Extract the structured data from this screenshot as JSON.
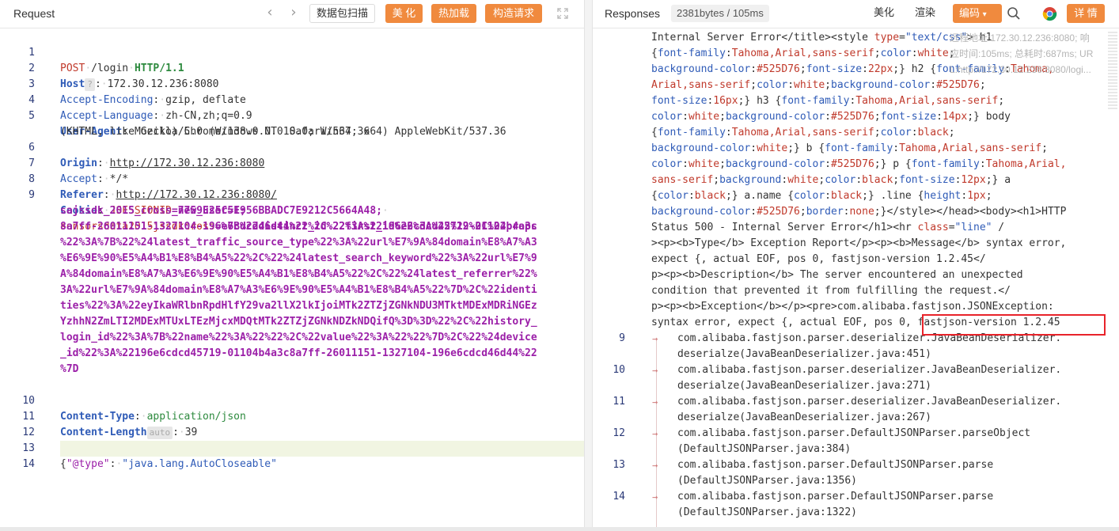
{
  "request": {
    "title": "Request",
    "buttons": {
      "scan": "数据包扫描",
      "beautify": "美 化",
      "hot_load": "热加载",
      "construct": "构造请求"
    },
    "lines": {
      "l1": {
        "method": "POST",
        "path": "/login",
        "proto": "HTTP/1.1"
      },
      "l2": {
        "name": "Host",
        "hint": "?",
        "value": "172.30.12.236:8080"
      },
      "l3": {
        "name": "Accept-Encoding",
        "value": "gzip, deflate"
      },
      "l4": {
        "name": "Accept-Language",
        "value": "zh-CN,zh;q=0.9"
      },
      "l5": {
        "name": "User-Agent",
        "value": "Mozilla/5.0 (Windows NT 10.0; Win64; x64) AppleWebKit/537.36",
        "value2": "(KHTML, like Gecko) Chrome/138.0.0.0 Safari/537.36"
      },
      "l6": {
        "name": "Origin",
        "value": "http://172.30.12.236:8080"
      },
      "l7": {
        "name": "Accept",
        "value": "*/*"
      },
      "l8": {
        "name": "Referer",
        "value": "http://172.30.12.236:8080/"
      },
      "l9": {
        "name": "Cookie",
        "ck1_name": "JSESSIONID",
        "ck1_value": "=7759E25C5F956BBADC7E9212C5664A48;",
        "ck2": "sajssdk_2015_cross_new_user=1;",
        "ck3_name": "sensorsdata2015jssdkcross",
        "ck3_rows": [
          "=%7B%22distinct_id%22%3A%22196e6cdcd45719-01104b4a3c",
          "8a7ff-26011151-1327104-196e6cdcd46d44%22%2C%22first_id%22%3A%22%22%2C%22props",
          "%22%3A%7B%22%24latest_traffic_source_type%22%3A%22url%E7%9A%84domain%E8%A7%A3",
          "%E6%9E%90%E5%A4%B1%E8%B4%A5%22%2C%22%24latest_search_keyword%22%3A%22url%E7%9",
          "A%84domain%E8%A7%A3%E6%9E%90%E5%A4%B1%E8%B4%A5%22%2C%22%24latest_referrer%22%",
          "3A%22url%E7%9A%84domain%E8%A7%A3%E6%9E%90%E5%A4%B1%E8%B4%A5%22%7D%2C%22identi",
          "ties%22%3A%22eyIkaWRlbnRpdHlfY29va2llX2lkIjoiMTk2ZTZjZGNkNDU3MTktMDExMDRiNGEz",
          "YzhhN2ZmLTI2MDExMTUxLTEzMjcxMDQtMTk2ZTZjZGNkNDZkNDQifQ%3D%3D%22%2C%22history_",
          "login_id%22%3A%7B%22name%22%3A%22%22%2C%22value%22%3A%22%22%7D%2C%22%24device",
          "_id%22%3A%22196e6cdcd45719-01104b4a3c8a7ff-26011151-1327104-196e6cdcd46d44%22",
          "%7D"
        ]
      },
      "l10": {
        "name": "Content-Type",
        "value": "application/json"
      },
      "l11": {
        "name": "Content-Length",
        "hint": "auto",
        "value": "39"
      },
      "l13": {
        "key": "\"@type\"",
        "sep": ":",
        "value": "\"java.lang.AutoCloseable\""
      }
    },
    "line_numbers": [
      "1",
      "2",
      "3",
      "4",
      "5",
      "6",
      "7",
      "8",
      "9",
      "10",
      "11",
      "12",
      "13",
      "14"
    ]
  },
  "response": {
    "title": "Responses",
    "size_badge": "2381bytes / 105ms",
    "buttons": {
      "beautify": "美化",
      "render": "渲染",
      "encoding": "编码",
      "details": "详 情"
    },
    "ghost_lines": [
      "远程地址:172.30.12.236:8080; 响",
      "应时间:105ms; 总耗时:687ms; UR",
      "L:http://172.30.12.236:8080/logi..."
    ],
    "html_rows": [
      {
        "parts": [
          [
            "t",
            "Internal Server Error</title><style "
          ],
          [
            "a",
            "type"
          ],
          [
            "t",
            "="
          ],
          [
            "s",
            "\"text/css\""
          ],
          [
            "t",
            "> h1 "
          ]
        ]
      },
      {
        "parts": [
          [
            "t",
            "{"
          ],
          [
            "p",
            "font-family"
          ],
          [
            "t",
            ":"
          ],
          [
            "v",
            "Tahoma,Arial,sans-serif"
          ],
          [
            "t",
            ";"
          ],
          [
            "p",
            "color"
          ],
          [
            "t",
            ":"
          ],
          [
            "v",
            "white"
          ],
          [
            "t",
            ";"
          ]
        ]
      },
      {
        "parts": [
          [
            "p",
            "background-color"
          ],
          [
            "t",
            ":"
          ],
          [
            "v",
            "#525D76"
          ],
          [
            "t",
            ";"
          ],
          [
            "p",
            "font-size"
          ],
          [
            "t",
            ":"
          ],
          [
            "v",
            "22px"
          ],
          [
            "t",
            ";} h2 {"
          ],
          [
            "p",
            "font-family"
          ],
          [
            "t",
            ":"
          ],
          [
            "v",
            "Tahoma,"
          ]
        ]
      },
      {
        "parts": [
          [
            "v",
            "Arial,sans-serif"
          ],
          [
            "t",
            ";"
          ],
          [
            "p",
            "color"
          ],
          [
            "t",
            ":"
          ],
          [
            "v",
            "white"
          ],
          [
            "t",
            ";"
          ],
          [
            "p",
            "background-color"
          ],
          [
            "t",
            ":"
          ],
          [
            "v",
            "#525D76"
          ],
          [
            "t",
            ";"
          ]
        ]
      },
      {
        "parts": [
          [
            "p",
            "font-size"
          ],
          [
            "t",
            ":"
          ],
          [
            "v",
            "16px"
          ],
          [
            "t",
            ";} h3 {"
          ],
          [
            "p",
            "font-family"
          ],
          [
            "t",
            ":"
          ],
          [
            "v",
            "Tahoma,Arial,sans-serif"
          ],
          [
            "t",
            ";"
          ]
        ]
      },
      {
        "parts": [
          [
            "p",
            "color"
          ],
          [
            "t",
            ":"
          ],
          [
            "v",
            "white"
          ],
          [
            "t",
            ";"
          ],
          [
            "p",
            "background-color"
          ],
          [
            "t",
            ":"
          ],
          [
            "v",
            "#525D76"
          ],
          [
            "t",
            ";"
          ],
          [
            "p",
            "font-size"
          ],
          [
            "t",
            ":"
          ],
          [
            "v",
            "14px"
          ],
          [
            "t",
            ";} body"
          ]
        ]
      },
      {
        "parts": [
          [
            "t",
            "{"
          ],
          [
            "p",
            "font-family"
          ],
          [
            "t",
            ":"
          ],
          [
            "v",
            "Tahoma,Arial,sans-serif"
          ],
          [
            "t",
            ";"
          ],
          [
            "p",
            "color"
          ],
          [
            "t",
            ":"
          ],
          [
            "v",
            "black"
          ],
          [
            "t",
            ";"
          ]
        ]
      },
      {
        "parts": [
          [
            "p",
            "background-color"
          ],
          [
            "t",
            ":"
          ],
          [
            "v",
            "white"
          ],
          [
            "t",
            ";} b {"
          ],
          [
            "p",
            "font-family"
          ],
          [
            "t",
            ":"
          ],
          [
            "v",
            "Tahoma,Arial,sans-serif"
          ],
          [
            "t",
            ";"
          ]
        ]
      },
      {
        "parts": [
          [
            "p",
            "color"
          ],
          [
            "t",
            ":"
          ],
          [
            "v",
            "white"
          ],
          [
            "t",
            ";"
          ],
          [
            "p",
            "background-color"
          ],
          [
            "t",
            ":"
          ],
          [
            "v",
            "#525D76"
          ],
          [
            "t",
            ";} p {"
          ],
          [
            "p",
            "font-family"
          ],
          [
            "t",
            ":"
          ],
          [
            "v",
            "Tahoma,Arial,"
          ]
        ]
      },
      {
        "parts": [
          [
            "v",
            "sans-serif"
          ],
          [
            "t",
            ";"
          ],
          [
            "p",
            "background"
          ],
          [
            "t",
            ":"
          ],
          [
            "v",
            "white"
          ],
          [
            "t",
            ";"
          ],
          [
            "p",
            "color"
          ],
          [
            "t",
            ":"
          ],
          [
            "v",
            "black"
          ],
          [
            "t",
            ";"
          ],
          [
            "p",
            "font-size"
          ],
          [
            "t",
            ":"
          ],
          [
            "v",
            "12px"
          ],
          [
            "t",
            ";} a"
          ]
        ]
      },
      {
        "parts": [
          [
            "t",
            "{"
          ],
          [
            "p",
            "color"
          ],
          [
            "t",
            ":"
          ],
          [
            "v",
            "black"
          ],
          [
            "t",
            ";} a.name {"
          ],
          [
            "p",
            "color"
          ],
          [
            "t",
            ":"
          ],
          [
            "v",
            "black"
          ],
          [
            "t",
            ";} .line {"
          ],
          [
            "p",
            "height"
          ],
          [
            "t",
            ":"
          ],
          [
            "v",
            "1px"
          ],
          [
            "t",
            ";"
          ]
        ]
      },
      {
        "parts": [
          [
            "p",
            "background-color"
          ],
          [
            "t",
            ":"
          ],
          [
            "v",
            "#525D76"
          ],
          [
            "t",
            ";"
          ],
          [
            "p",
            "border"
          ],
          [
            "t",
            ":"
          ],
          [
            "v",
            "none"
          ],
          [
            "t",
            ";}</style></head><body><h1>HTTP"
          ]
        ]
      },
      {
        "parts": [
          [
            "t",
            "Status 500 - Internal Server Error</h1><hr "
          ],
          [
            "a",
            "class"
          ],
          [
            "t",
            "="
          ],
          [
            "s",
            "\"line\""
          ],
          [
            "t",
            " /"
          ]
        ]
      },
      {
        "parts": [
          [
            "t",
            "><p><b>Type</b> Exception Report</p><p><b>Message</b> syntax error,"
          ]
        ]
      },
      {
        "parts": [
          [
            "t",
            "expect {, actual EOF, pos 0, fastjson-version 1.2.45</"
          ]
        ]
      },
      {
        "parts": [
          [
            "t",
            "p><p><b>Description</b> The server encountered an unexpected"
          ]
        ]
      },
      {
        "parts": [
          [
            "t",
            "condition that prevented it from fulfilling the request.</"
          ]
        ]
      },
      {
        "parts": [
          [
            "t",
            "p><p><b>Exception</b></p><pre>com.alibaba.fastjson.JSONException:"
          ]
        ]
      },
      {
        "parts": [
          [
            "t",
            "syntax error, expect {, actual EOF, pos 0, fastjson-version 1.2.45"
          ]
        ]
      }
    ],
    "stack_rows": [
      {
        "num": "9",
        "l1": "com.alibaba.fastjson.parser.deserializer.JavaBeanDeserializer.",
        "l2": "deserialze(JavaBeanDeserializer.java:451)"
      },
      {
        "num": "10",
        "l1": "com.alibaba.fastjson.parser.deserializer.JavaBeanDeserializer.",
        "l2": "deserialze(JavaBeanDeserializer.java:271)"
      },
      {
        "num": "11",
        "l1": "com.alibaba.fastjson.parser.deserializer.JavaBeanDeserializer.",
        "l2": "deserialze(JavaBeanDeserializer.java:267)"
      },
      {
        "num": "12",
        "l1": "com.alibaba.fastjson.parser.DefaultJSONParser.parseObject",
        "l2": "(DefaultJSONParser.java:384)"
      },
      {
        "num": "13",
        "l1": "com.alibaba.fastjson.parser.DefaultJSONParser.parse",
        "l2": "(DefaultJSONParser.java:1356)"
      },
      {
        "num": "14",
        "l1": "com.alibaba.fastjson.parser.DefaultJSONParser.parse",
        "l2": "(DefaultJSONParser.java:1322)"
      }
    ]
  },
  "colors": {
    "accent_orange": "#f08a3e",
    "highlight_red": "#e8232a"
  }
}
